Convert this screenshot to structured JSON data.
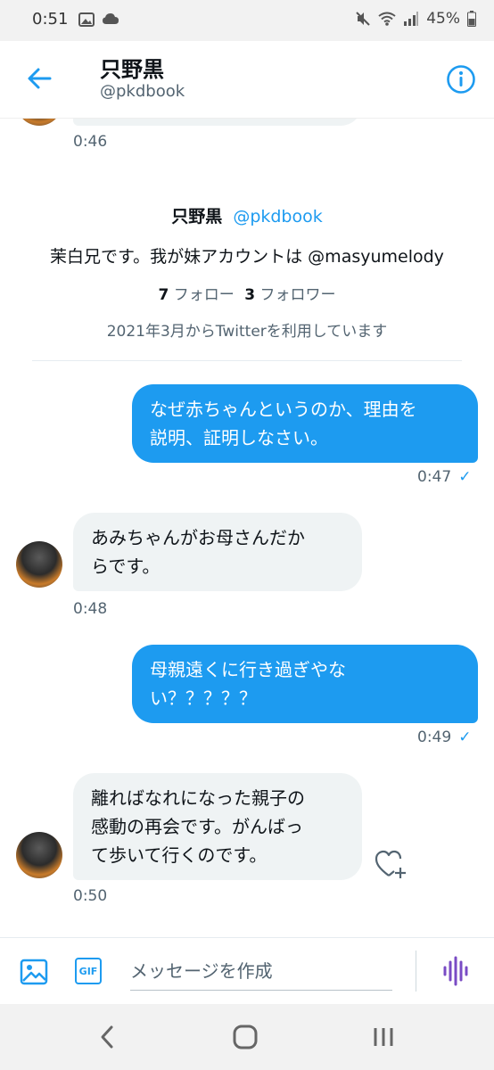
{
  "status": {
    "time": "0:51",
    "battery": "45%"
  },
  "header": {
    "name": "只野黒",
    "handle": "@pkdbook"
  },
  "profile": {
    "name": "只野黒",
    "handle": "@pkdbook",
    "bio": "茉白兄です。我が妹アカウントは @masyumelody",
    "following_count": "7",
    "following_label": "フォロー",
    "followers_count": "3",
    "followers_label": "フォロワー",
    "joined": "2021年3月からTwitterを利用しています"
  },
  "messages": [
    {
      "dir": "in",
      "time": "0:46"
    },
    {
      "dir": "out",
      "lines": [
        "なぜ赤ちゃんというのか、理由を",
        "説明、証明しなさい。"
      ],
      "time": "0:47"
    },
    {
      "dir": "in",
      "lines": [
        "あみちゃんがお母さんだか",
        "らです。"
      ],
      "time": "0:48"
    },
    {
      "dir": "out",
      "lines": [
        "母親遠くに行き過ぎやな",
        "い？？？？？"
      ],
      "time": "0:49"
    },
    {
      "dir": "in",
      "lines": [
        "離ればなれになった親子の",
        "感動の再会です。がんばっ",
        "て歩いて行くのです。"
      ],
      "time": "0:50"
    }
  ],
  "composer": {
    "placeholder": "メッセージを作成",
    "gif_label": "GIF"
  },
  "colors": {
    "accent": "#1d9bf0",
    "bubble_in": "#eff3f4",
    "voice": "#794bc4"
  }
}
